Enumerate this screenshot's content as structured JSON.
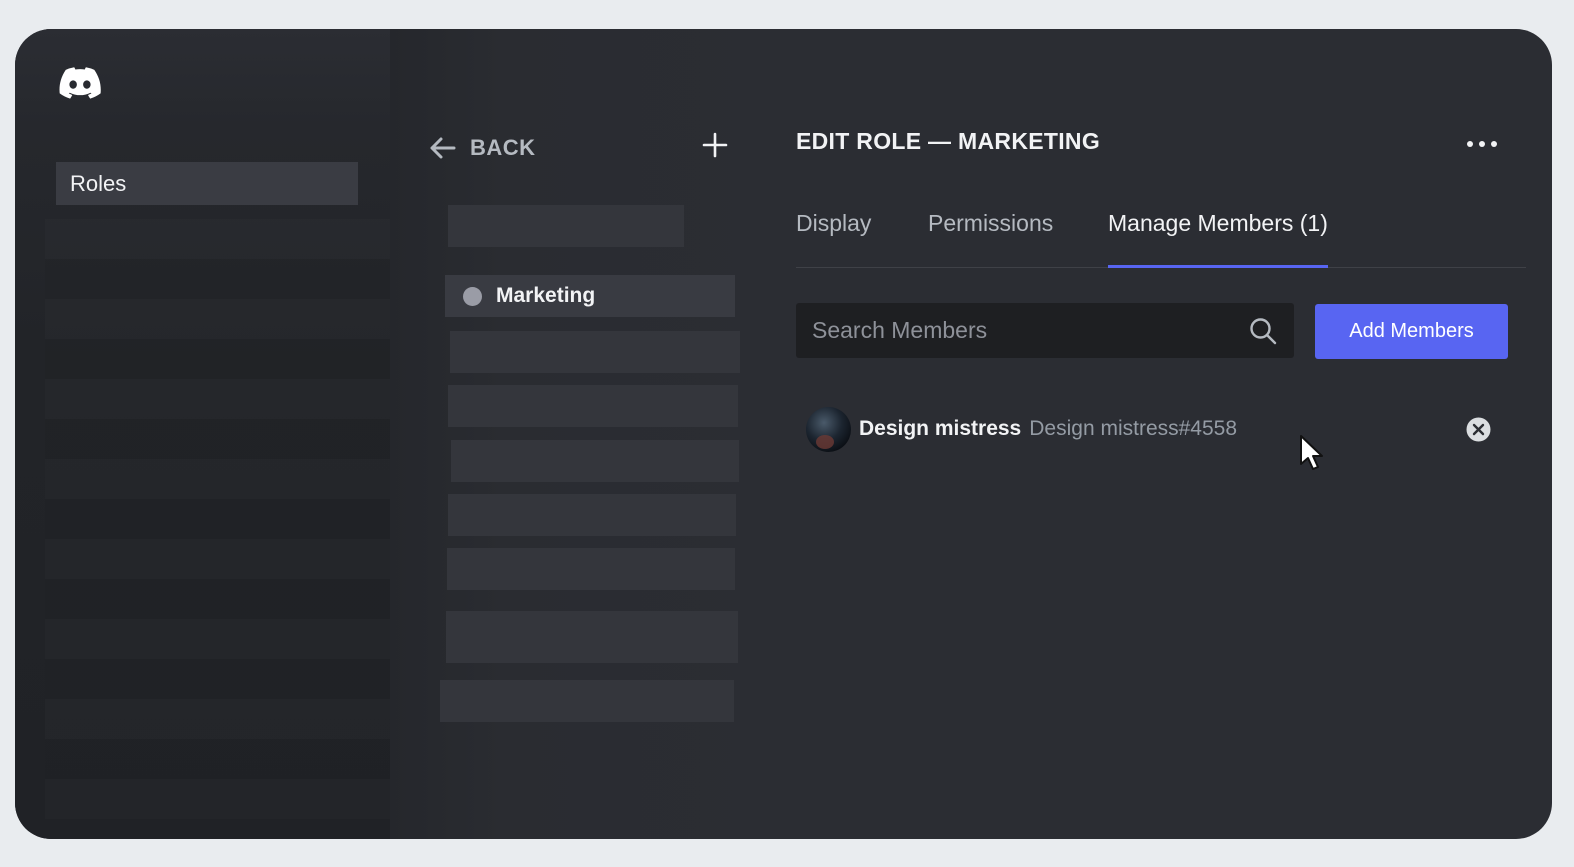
{
  "sidebar": {
    "items": [
      {
        "label": "Roles"
      }
    ]
  },
  "roles_panel": {
    "back_label": "BACK",
    "roles": [
      {
        "name": "Marketing",
        "color": "#9a9ca6"
      }
    ]
  },
  "main": {
    "title": "EDIT ROLE — MARKETING",
    "tabs": [
      {
        "label": "Display"
      },
      {
        "label": "Permissions"
      },
      {
        "label": "Manage Members (1)",
        "active": true
      }
    ],
    "search": {
      "placeholder": "Search Members",
      "value": ""
    },
    "add_button_label": "Add Members",
    "members": [
      {
        "display_name": "Design mistress",
        "tag": "Design mistress#4558"
      }
    ]
  },
  "icons": {
    "logo": "discord-logo-icon",
    "back": "arrow-left-icon",
    "add": "plus-icon",
    "more": "more-dots-icon",
    "search": "search-icon",
    "remove": "close-circle-icon",
    "cursor": "mouse-pointer-icon"
  },
  "colors": {
    "accent": "#5865f2",
    "background": "#2b2d33",
    "input_background": "#1e1f22"
  }
}
